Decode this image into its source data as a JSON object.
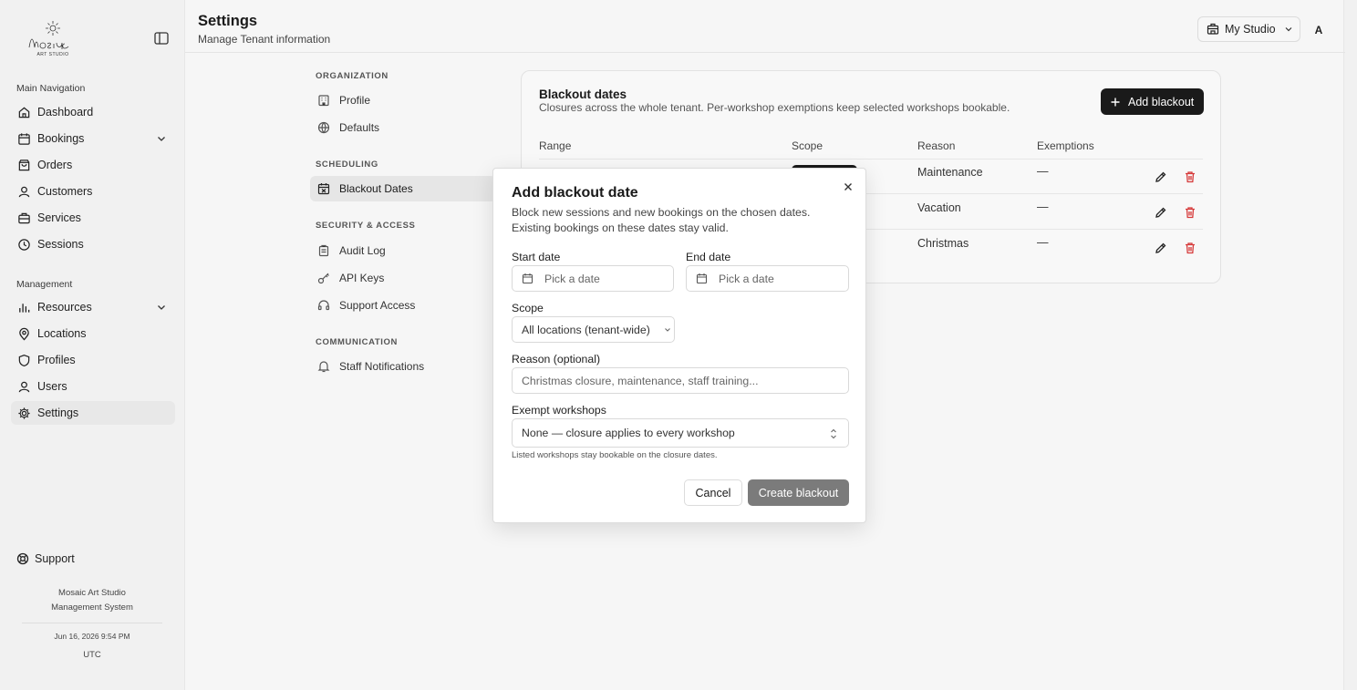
{
  "sidebar": {
    "logo_text": "Mosaic Art Studio",
    "main_nav_label": "Main Navigation",
    "main_items": [
      {
        "label": "Dashboard",
        "icon": "home-icon"
      },
      {
        "label": "Bookings",
        "icon": "calendar-icon",
        "expandable": true
      },
      {
        "label": "Orders",
        "icon": "bag-icon"
      },
      {
        "label": "Customers",
        "icon": "user-icon"
      },
      {
        "label": "Services",
        "icon": "briefcase-icon"
      },
      {
        "label": "Sessions",
        "icon": "clock-icon"
      }
    ],
    "management_label": "Management",
    "management_items": [
      {
        "label": "Resources",
        "icon": "chart-icon",
        "expandable": true
      },
      {
        "label": "Locations",
        "icon": "pin-icon"
      },
      {
        "label": "Profiles",
        "icon": "shield-icon"
      },
      {
        "label": "Users",
        "icon": "user-icon"
      },
      {
        "label": "Settings",
        "icon": "gear-icon",
        "active": true
      }
    ],
    "support_label": "Support",
    "footer_brand_line1": "Mosaic Art Studio",
    "footer_brand_line2": "Management System",
    "footer_datetime": "Jun 16, 2026 9:54 PM",
    "footer_timezone": "UTC"
  },
  "header": {
    "title": "Settings",
    "subtitle": "Manage Tenant information",
    "studio_label": "My Studio",
    "avatar_initial": "A"
  },
  "settings_nav": {
    "sections": [
      {
        "label": "Organization",
        "items": [
          {
            "label": "Profile"
          },
          {
            "label": "Defaults"
          }
        ]
      },
      {
        "label": "Scheduling",
        "items": [
          {
            "label": "Blackout Dates",
            "active": true
          }
        ]
      },
      {
        "label": "Security & Access",
        "items": [
          {
            "label": "Audit Log"
          },
          {
            "label": "API Keys"
          },
          {
            "label": "Support Access"
          }
        ]
      },
      {
        "label": "Communication",
        "items": [
          {
            "label": "Staff Notifications"
          }
        ]
      }
    ]
  },
  "blackout_card": {
    "title": "Blackout dates",
    "subtitle": "Closures across the whole tenant. Per-workshop exemptions keep selected workshops bookable.",
    "add_button": "Add blackout",
    "columns": [
      "Range",
      "Scope",
      "Reason",
      "Exemptions"
    ],
    "rows": [
      {
        "reason": "Maintenance",
        "exemptions": "—"
      },
      {
        "reason": "Vacation",
        "exemptions": "—"
      },
      {
        "reason": "Christmas",
        "exemptions": "—"
      }
    ]
  },
  "modal": {
    "title": "Add blackout date",
    "description": "Block new sessions and new bookings on the chosen dates. Existing bookings on these dates stay valid.",
    "start_label": "Start date",
    "start_placeholder": "Pick a date",
    "end_label": "End date",
    "end_placeholder": "Pick a date",
    "scope_label": "Scope",
    "scope_value": "All locations (tenant-wide)",
    "reason_label": "Reason (optional)",
    "reason_placeholder": "Christmas closure, maintenance, staff training...",
    "exempt_label": "Exempt workshops",
    "exempt_value": "None — closure applies to every workshop",
    "exempt_help": "Listed workshops stay bookable on the closure dates.",
    "cancel_label": "Cancel",
    "create_label": "Create blackout"
  },
  "colors": {
    "primary": "#1a1a1a",
    "danger": "#d63a3a",
    "disabled_button": "#7b7b7b",
    "background": "#f1f1f1"
  }
}
